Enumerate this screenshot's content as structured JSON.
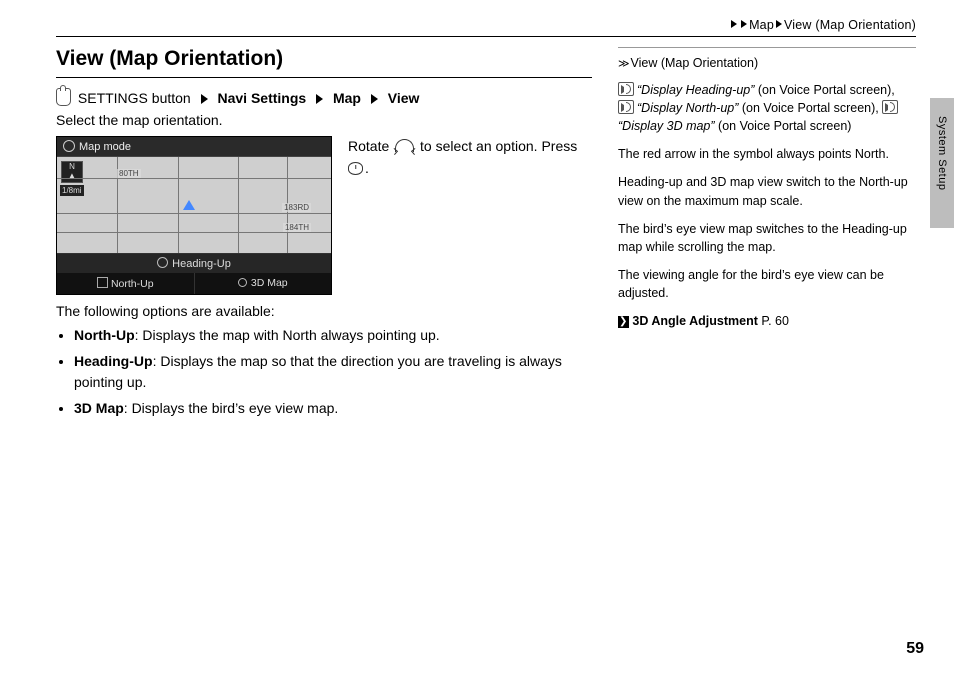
{
  "breadcrumbs": {
    "seg1": "Map",
    "seg2": "View (Map Orientation)"
  },
  "title": "View (Map Orientation)",
  "path": {
    "button": "SETTINGS button",
    "s1": "Navi Settings",
    "s2": "Map",
    "s3": "View"
  },
  "intro": "Select the map orientation.",
  "figure": {
    "title": "Map mode",
    "scale": "1/8mi",
    "road1": "80TH",
    "road2": "183RD",
    "road3": "184TH",
    "opt_header": "Heading-Up",
    "opt_left": "North-Up",
    "opt_right": "3D Map"
  },
  "rotate": {
    "pre": "Rotate ",
    "mid": " to select an option. Press ",
    "post": "."
  },
  "available_label": "The following options are available:",
  "options": [
    {
      "name": "North-Up",
      "desc": ": Displays the map with North always pointing up."
    },
    {
      "name": "Heading-Up",
      "desc": ": Displays the map so that the direction you are traveling is always pointing up."
    },
    {
      "name": "3D Map",
      "desc": ": Displays the bird’s eye view map."
    }
  ],
  "side": {
    "head": "View (Map Orientation)",
    "v1": "“Display Heading-up”",
    "v1s": " (on Voice Portal screen), ",
    "v2": "“Display North-up”",
    "v2s": " (on Voice Portal screen), ",
    "v3": "“Display 3D map”",
    "v3s": " (on Voice Portal screen)",
    "p1": "The red arrow in the symbol always points North.",
    "p2": "Heading-up and 3D map view switch to the North-up view on the maximum map scale.",
    "p3": "The bird’s eye view map switches to the Heading-up map while scrolling the map.",
    "p4": "The viewing angle for the bird’s eye view can be adjusted.",
    "xref_label": "3D Angle Adjustment",
    "xref_page": " P. 60"
  },
  "side_tab": "System Setup",
  "page_number": "59"
}
